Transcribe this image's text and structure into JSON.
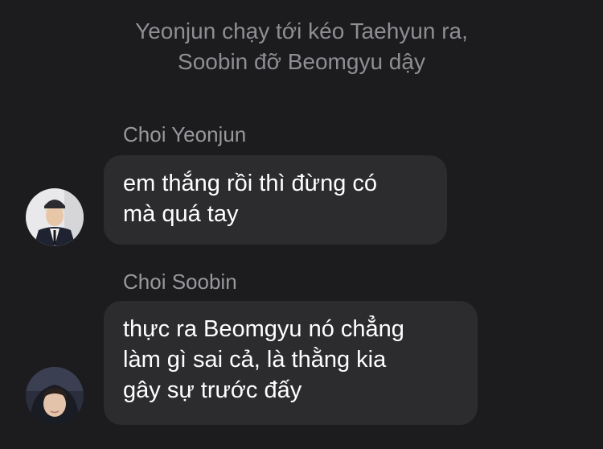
{
  "system_message": {
    "line1": "Yeonjun chạy tới kéo Taehyun ra,",
    "line2": "Soobin đỡ Beomgyu dậy"
  },
  "messages": [
    {
      "sender": "Choi Yeonjun",
      "lines": [
        "em thắng rồi thì đừng có",
        "mà quá tay"
      ],
      "avatar_icon": "yeonjun-avatar"
    },
    {
      "sender": "Choi Soobin",
      "lines": [
        "thực ra Beomgyu nó chẳng",
        "làm gì sai cả, là thằng kia",
        "gây sự trước đấy"
      ],
      "avatar_icon": "soobin-avatar"
    }
  ],
  "colors": {
    "background": "#1c1c1e",
    "bubble": "#2c2c2e",
    "text": "#ffffff",
    "muted": "#8e8e93"
  }
}
